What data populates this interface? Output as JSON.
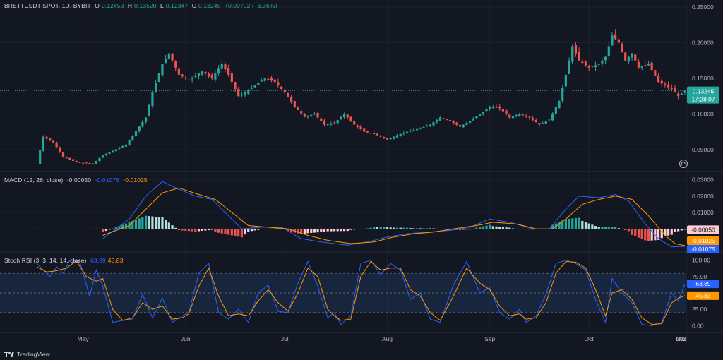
{
  "header": {
    "symbol": "BRETTUSDT SPOT, 1D, BYBIT",
    "open_label": "O",
    "open": "0.12453",
    "high_label": "H",
    "high": "0.13520",
    "low_label": "L",
    "low": "0.12347",
    "close_label": "C",
    "close": "0.13245",
    "change": "+0.00792 (+6.36%)"
  },
  "macd_header": {
    "name": "MACD (12, 26, close)",
    "hist": "-0.00050",
    "macd": "-0.01075",
    "signal": "-0.01025"
  },
  "rsi_header": {
    "name": "Stoch RSI (3, 3, 14, 14, close)",
    "k": "63.89",
    "d": "45.83"
  },
  "price_badge": {
    "value": "0.13245",
    "countdown": "17:28:07"
  },
  "macd_badges": {
    "hist": "-0.00050",
    "signal": "-0.01025",
    "macd": "-0.01075"
  },
  "rsi_badges": {
    "k": "63.89",
    "d": "45.83"
  },
  "branding": {
    "name": "TradingView"
  },
  "colors": {
    "background": "#131722",
    "up": "#26a69a",
    "down": "#ef5350",
    "macd_line": "#2962ff",
    "signal_line": "#ff9800",
    "hist_up": "#b2dfdb",
    "hist_up_strong": "#26a69a",
    "hist_down": "#ffcdd2",
    "hist_down_strong": "#ef5350",
    "rsi_band": "#1e3a5f"
  },
  "chart_data": [
    {
      "type": "candlestick",
      "title": "BRETTUSDT SPOT, 1D, BYBIT",
      "ylim": [
        0.03,
        0.25
      ],
      "y_ticks": [
        "0.25000",
        "0.20000",
        "0.15000",
        "0.10000",
        "0.05000"
      ],
      "y_tick_values": [
        0.25,
        0.2,
        0.15,
        0.1,
        0.05
      ],
      "x_ticks": [
        "May",
        "Jun",
        "Jul",
        "Aug",
        "Sep",
        "Oct",
        "Nov",
        "Dec",
        "202"
      ],
      "x_tick_index": [
        14,
        45,
        75,
        106,
        137,
        167,
        198,
        228,
        259
      ],
      "last_close": 0.13245,
      "anchors": [
        [
          0,
          0.03
        ],
        [
          2,
          0.068
        ],
        [
          5,
          0.06
        ],
        [
          8,
          0.04
        ],
        [
          12,
          0.032
        ],
        [
          17,
          0.03
        ],
        [
          20,
          0.042
        ],
        [
          23,
          0.048
        ],
        [
          27,
          0.057
        ],
        [
          30,
          0.076
        ],
        [
          33,
          0.095
        ],
        [
          35,
          0.13
        ],
        [
          38,
          0.17
        ],
        [
          40,
          0.185
        ],
        [
          43,
          0.155
        ],
        [
          46,
          0.148
        ],
        [
          50,
          0.16
        ],
        [
          53,
          0.15
        ],
        [
          56,
          0.17
        ],
        [
          58,
          0.155
        ],
        [
          61,
          0.125
        ],
        [
          63,
          0.13
        ],
        [
          66,
          0.14
        ],
        [
          69,
          0.15
        ],
        [
          72,
          0.145
        ],
        [
          75,
          0.13
        ],
        [
          78,
          0.11
        ],
        [
          81,
          0.096
        ],
        [
          84,
          0.1
        ],
        [
          87,
          0.085
        ],
        [
          90,
          0.087
        ],
        [
          93,
          0.1
        ],
        [
          96,
          0.085
        ],
        [
          99,
          0.075
        ],
        [
          102,
          0.072
        ],
        [
          106,
          0.064
        ],
        [
          109,
          0.07
        ],
        [
          112,
          0.075
        ],
        [
          116,
          0.08
        ],
        [
          119,
          0.085
        ],
        [
          122,
          0.095
        ],
        [
          125,
          0.09
        ],
        [
          128,
          0.082
        ],
        [
          131,
          0.09
        ],
        [
          134,
          0.1
        ],
        [
          137,
          0.11
        ],
        [
          140,
          0.108
        ],
        [
          143,
          0.095
        ],
        [
          146,
          0.1
        ],
        [
          149,
          0.095
        ],
        [
          152,
          0.085
        ],
        [
          155,
          0.092
        ],
        [
          158,
          0.118
        ],
        [
          160,
          0.155
        ],
        [
          162,
          0.195
        ],
        [
          164,
          0.175
        ],
        [
          167,
          0.165
        ],
        [
          170,
          0.17
        ],
        [
          172,
          0.18
        ],
        [
          174,
          0.21
        ],
        [
          176,
          0.2
        ],
        [
          178,
          0.175
        ],
        [
          180,
          0.185
        ],
        [
          182,
          0.165
        ],
        [
          185,
          0.17
        ],
        [
          188,
          0.145
        ],
        [
          190,
          0.14
        ],
        [
          192,
          0.135
        ],
        [
          194,
          0.125
        ],
        [
          196,
          0.132
        ]
      ]
    },
    {
      "type": "line",
      "title": "MACD (12, 26, close)",
      "ylim": [
        -0.012,
        0.032
      ],
      "y_ticks": [
        "0.03000",
        "0.02000",
        "0.01000"
      ],
      "y_tick_values": [
        0.03,
        0.02,
        0.01
      ],
      "series": [
        {
          "name": "MACD",
          "anchors": [
            [
              20,
              -0.006
            ],
            [
              28,
              0.006
            ],
            [
              33,
              0.02
            ],
            [
              38,
              0.029
            ],
            [
              42,
              0.025
            ],
            [
              48,
              0.02
            ],
            [
              53,
              0.018
            ],
            [
              58,
              0.008
            ],
            [
              62,
              0.0
            ],
            [
              68,
              0.001
            ],
            [
              74,
              0.001
            ],
            [
              80,
              -0.006
            ],
            [
              86,
              -0.008
            ],
            [
              94,
              -0.01
            ],
            [
              100,
              -0.008
            ],
            [
              106,
              -0.005
            ],
            [
              112,
              -0.003
            ],
            [
              118,
              -0.002
            ],
            [
              125,
              -0.001
            ],
            [
              131,
              0.001
            ],
            [
              137,
              0.006
            ],
            [
              143,
              0.004
            ],
            [
              150,
              0.0
            ],
            [
              155,
              0.0
            ],
            [
              160,
              0.012
            ],
            [
              164,
              0.02
            ],
            [
              170,
              0.019
            ],
            [
              175,
              0.021
            ],
            [
              179,
              0.017
            ],
            [
              184,
              0.003
            ],
            [
              188,
              -0.006
            ],
            [
              192,
              -0.011
            ],
            [
              196,
              -0.01075
            ]
          ]
        },
        {
          "name": "Signal",
          "anchors": [
            [
              20,
              -0.004
            ],
            [
              28,
              0.002
            ],
            [
              33,
              0.012
            ],
            [
              38,
              0.022
            ],
            [
              43,
              0.025
            ],
            [
              49,
              0.021
            ],
            [
              54,
              0.018
            ],
            [
              59,
              0.01
            ],
            [
              64,
              0.002
            ],
            [
              70,
              0.001
            ],
            [
              76,
              0.0
            ],
            [
              82,
              -0.004
            ],
            [
              88,
              -0.007
            ],
            [
              95,
              -0.009
            ],
            [
              102,
              -0.008
            ],
            [
              108,
              -0.005
            ],
            [
              114,
              -0.003
            ],
            [
              120,
              -0.002
            ],
            [
              126,
              0.0
            ],
            [
              133,
              0.002
            ],
            [
              138,
              0.004
            ],
            [
              145,
              0.003
            ],
            [
              151,
              0.0
            ],
            [
              156,
              0.0
            ],
            [
              160,
              0.006
            ],
            [
              165,
              0.015
            ],
            [
              170,
              0.018
            ],
            [
              175,
              0.02
            ],
            [
              180,
              0.018
            ],
            [
              185,
              0.008
            ],
            [
              190,
              -0.004
            ],
            [
              193,
              -0.009
            ],
            [
              196,
              -0.01025
            ]
          ]
        }
      ],
      "histogram_last": -0.0005
    },
    {
      "type": "line",
      "title": "Stoch RSI (3, 3, 14, 14, close)",
      "ylim": [
        -5,
        105
      ],
      "y_ticks": [
        "100.00",
        "75.00",
        "25.00",
        "0.00"
      ],
      "y_tick_values": [
        100,
        75,
        25,
        0
      ],
      "band": [
        20,
        80
      ],
      "series": [
        {
          "name": "K",
          "anchors": [
            [
              0,
              95
            ],
            [
              2,
              85
            ],
            [
              4,
              75
            ],
            [
              6,
              90
            ],
            [
              8,
              80
            ],
            [
              10,
              100
            ],
            [
              13,
              98
            ],
            [
              16,
              45
            ],
            [
              18,
              85
            ],
            [
              20,
              60
            ],
            [
              23,
              5
            ],
            [
              26,
              8
            ],
            [
              29,
              10
            ],
            [
              32,
              48
            ],
            [
              35,
              12
            ],
            [
              38,
              42
            ],
            [
              41,
              5
            ],
            [
              44,
              15
            ],
            [
              46,
              20
            ],
            [
              49,
              80
            ],
            [
              52,
              95
            ],
            [
              55,
              20
            ],
            [
              58,
              10
            ],
            [
              61,
              25
            ],
            [
              64,
              5
            ],
            [
              67,
              50
            ],
            [
              70,
              62
            ],
            [
              73,
              22
            ],
            [
              76,
              20
            ],
            [
              79,
              65
            ],
            [
              82,
              98
            ],
            [
              85,
              60
            ],
            [
              88,
              12
            ],
            [
              90,
              20
            ],
            [
              92,
              2
            ],
            [
              95,
              15
            ],
            [
              98,
              95
            ],
            [
              101,
              100
            ],
            [
              104,
              78
            ],
            [
              107,
              95
            ],
            [
              110,
              85
            ],
            [
              113,
              40
            ],
            [
              116,
              50
            ],
            [
              119,
              10
            ],
            [
              122,
              5
            ],
            [
              126,
              62
            ],
            [
              130,
              98
            ],
            [
              134,
              50
            ],
            [
              137,
              58
            ],
            [
              140,
              20
            ],
            [
              143,
              10
            ],
            [
              146,
              25
            ],
            [
              148,
              5
            ],
            [
              151,
              15
            ],
            [
              154,
              48
            ],
            [
              157,
              95
            ],
            [
              160,
              100
            ],
            [
              163,
              95
            ],
            [
              166,
              85
            ],
            [
              169,
              40
            ],
            [
              172,
              5
            ],
            [
              174,
              72
            ],
            [
              177,
              50
            ],
            [
              180,
              35
            ],
            [
              183,
              2
            ],
            [
              186,
              0
            ],
            [
              189,
              5
            ],
            [
              192,
              50
            ],
            [
              194,
              38
            ],
            [
              196,
              63.89
            ]
          ]
        },
        {
          "name": "D",
          "anchors": [
            [
              0,
              90
            ],
            [
              3,
              82
            ],
            [
              6,
              84
            ],
            [
              9,
              88
            ],
            [
              12,
              99
            ],
            [
              15,
              75
            ],
            [
              18,
              68
            ],
            [
              20,
              72
            ],
            [
              23,
              25
            ],
            [
              26,
              8
            ],
            [
              29,
              12
            ],
            [
              32,
              35
            ],
            [
              35,
              25
            ],
            [
              38,
              30
            ],
            [
              41,
              10
            ],
            [
              44,
              12
            ],
            [
              46,
              18
            ],
            [
              49,
              60
            ],
            [
              52,
              88
            ],
            [
              55,
              45
            ],
            [
              58,
              15
            ],
            [
              61,
              18
            ],
            [
              64,
              15
            ],
            [
              67,
              38
            ],
            [
              70,
              55
            ],
            [
              73,
              35
            ],
            [
              76,
              22
            ],
            [
              79,
              50
            ],
            [
              82,
              88
            ],
            [
              85,
              75
            ],
            [
              88,
              25
            ],
            [
              90,
              15
            ],
            [
              92,
              8
            ],
            [
              95,
              10
            ],
            [
              98,
              75
            ],
            [
              101,
              98
            ],
            [
              104,
              85
            ],
            [
              107,
              88
            ],
            [
              110,
              88
            ],
            [
              113,
              55
            ],
            [
              116,
              45
            ],
            [
              119,
              20
            ],
            [
              122,
              8
            ],
            [
              126,
              45
            ],
            [
              130,
              88
            ],
            [
              134,
              65
            ],
            [
              137,
              55
            ],
            [
              140,
              30
            ],
            [
              143,
              15
            ],
            [
              146,
              18
            ],
            [
              148,
              10
            ],
            [
              151,
              12
            ],
            [
              154,
              35
            ],
            [
              157,
              80
            ],
            [
              160,
              98
            ],
            [
              163,
              97
            ],
            [
              166,
              88
            ],
            [
              169,
              55
            ],
            [
              172,
              15
            ],
            [
              174,
              50
            ],
            [
              177,
              55
            ],
            [
              180,
              40
            ],
            [
              183,
              12
            ],
            [
              186,
              2
            ],
            [
              189,
              3
            ],
            [
              192,
              35
            ],
            [
              194,
              42
            ],
            [
              196,
              45.83
            ]
          ]
        }
      ]
    }
  ]
}
